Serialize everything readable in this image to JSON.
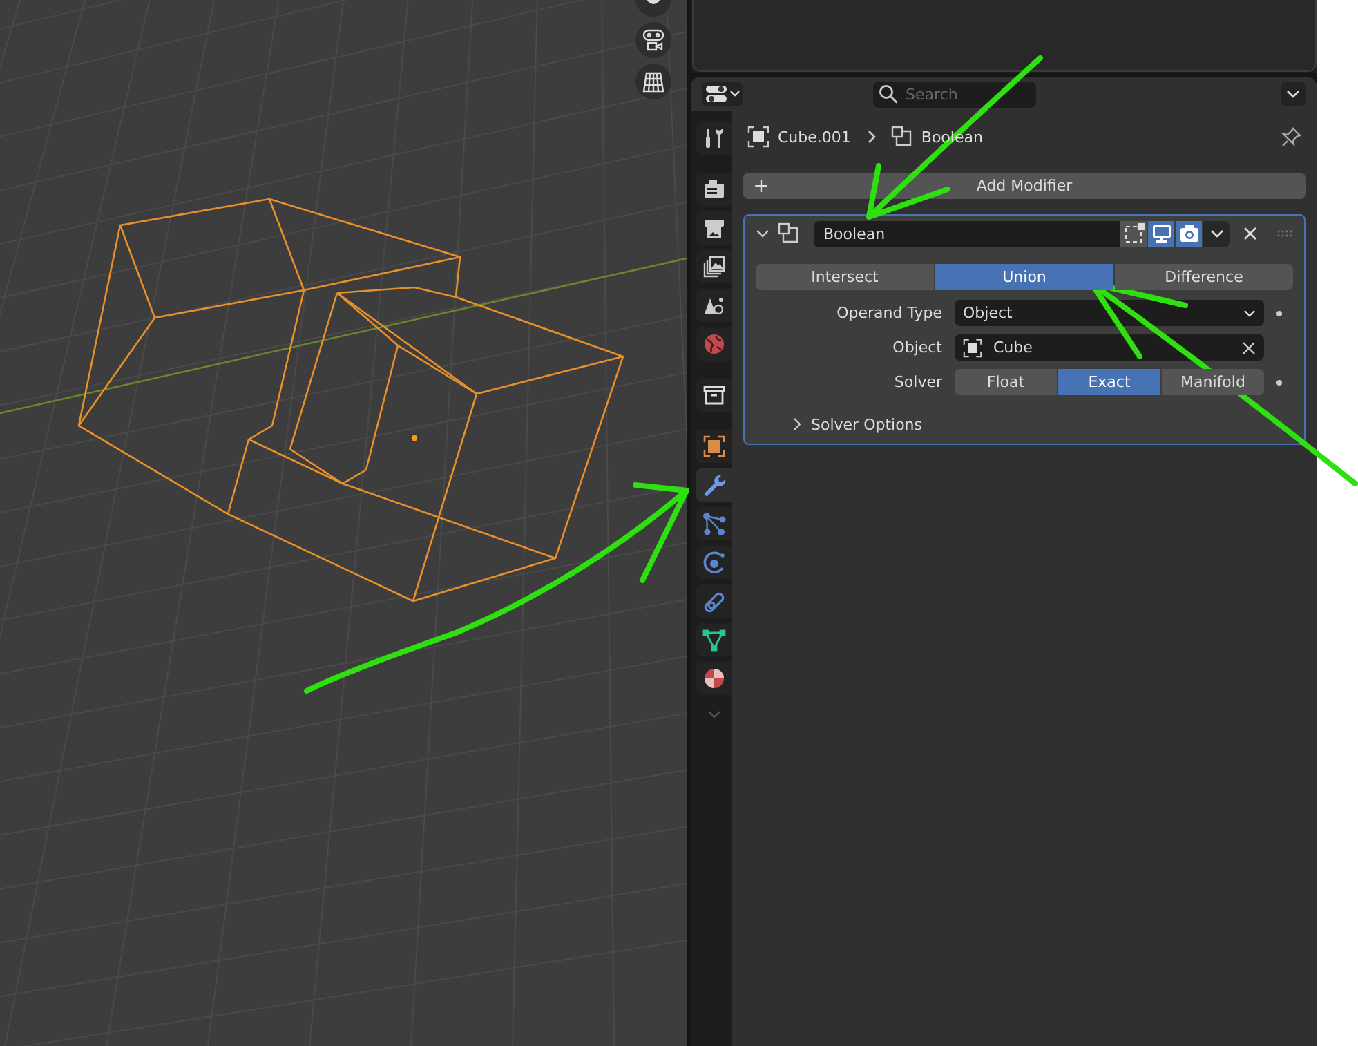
{
  "header": {
    "search": {
      "placeholder": "Search"
    }
  },
  "breadcrumb": {
    "object": "Cube.001",
    "modifier": "Boolean"
  },
  "add_modifier": {
    "plus": "+",
    "label": "Add Modifier"
  },
  "tabs": [
    {
      "kind": "tool",
      "selected": false
    },
    {
      "kind": "render",
      "selected": false
    },
    {
      "kind": "output",
      "selected": false
    },
    {
      "kind": "view_layer",
      "selected": false
    },
    {
      "kind": "scene",
      "selected": false
    },
    {
      "kind": "world",
      "selected": false
    },
    {
      "kind": "collection",
      "selected": false
    },
    {
      "kind": "object",
      "selected": false
    },
    {
      "kind": "modifiers",
      "selected": true
    },
    {
      "kind": "particles",
      "selected": false
    },
    {
      "kind": "physics",
      "selected": false
    },
    {
      "kind": "constraints",
      "selected": false
    },
    {
      "kind": "data",
      "selected": false
    },
    {
      "kind": "material",
      "selected": false
    }
  ],
  "modifier": {
    "name": "Boolean",
    "expanded": true,
    "toggles": [
      {
        "kind": "edit_mode",
        "on": false
      },
      {
        "kind": "viewport",
        "on": true
      },
      {
        "kind": "render",
        "on": true
      }
    ],
    "operations": [
      {
        "label": "Intersect",
        "selected": false
      },
      {
        "label": "Union",
        "selected": true
      },
      {
        "label": "Difference",
        "selected": false
      }
    ],
    "operand_type": {
      "label": "Operand Type",
      "value": "Object"
    },
    "object": {
      "label": "Object",
      "value": "Cube"
    },
    "solver": {
      "label": "Solver",
      "options": [
        {
          "label": "Float",
          "selected": false
        },
        {
          "label": "Exact",
          "selected": true
        },
        {
          "label": "Manifold",
          "selected": false
        }
      ]
    },
    "solver_options": {
      "label": "Solver Options",
      "expanded": false
    }
  }
}
